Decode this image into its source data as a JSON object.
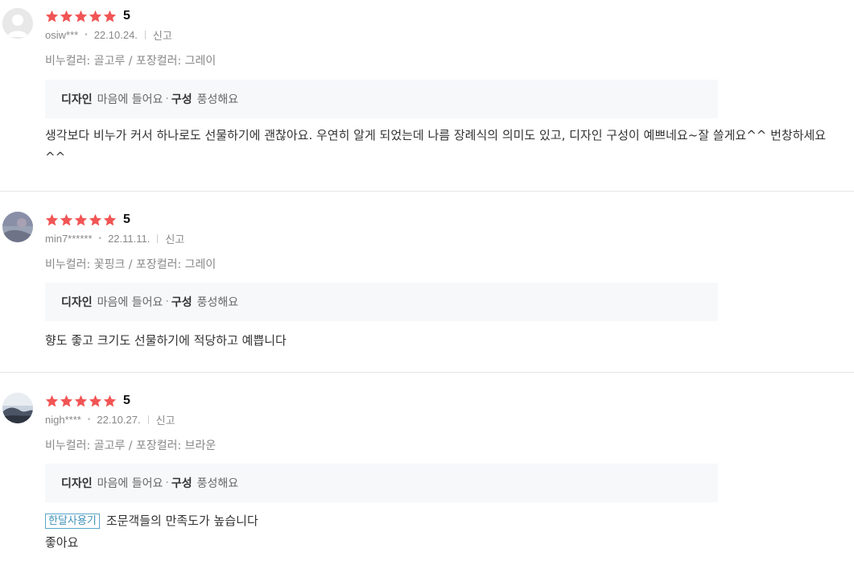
{
  "reviews": [
    {
      "score": "5",
      "user": "osiw***",
      "date": "22.10.24.",
      "report": "신고",
      "option": "비누컬러: 골고루 / 포장컬러: 그레이",
      "eval": [
        {
          "key": "디자인",
          "value": "마음에 들어요"
        },
        {
          "key": "구성",
          "value": "풍성해요"
        }
      ],
      "badge": "",
      "headline": "",
      "text": "생각보다 비누가 커서 하나로도 선물하기에 괜찮아요. 우연히 알게 되었는데 나름 장례식의 의미도 있고, 디자인 구성이 예쁘네요~잘 쓸게요^^ 번창하세요^^"
    },
    {
      "score": "5",
      "user": "min7******",
      "date": "22.11.11.",
      "report": "신고",
      "option": "비누컬러: 꽃핑크 / 포장컬러: 그레이",
      "eval": [
        {
          "key": "디자인",
          "value": "마음에 들어요"
        },
        {
          "key": "구성",
          "value": "풍성해요"
        }
      ],
      "badge": "",
      "headline": "",
      "text": "향도 좋고 크기도 선물하기에 적당하고 예쁩니다"
    },
    {
      "score": "5",
      "user": "nigh****",
      "date": "22.10.27.",
      "report": "신고",
      "option": "비누컬러: 골고루 / 포장컬러: 브라운",
      "eval": [
        {
          "key": "디자인",
          "value": "마음에 들어요"
        },
        {
          "key": "구성",
          "value": "풍성해요"
        }
      ],
      "badge": "한달사용기",
      "headline": "조문객들의 만족도가 높습니다",
      "text": "좋아요"
    }
  ],
  "colors": {
    "star": "#f15555",
    "badge_border": "#5aa6c9",
    "eval_bg": "#f7f8fa"
  },
  "icons": {
    "star": "star-icon",
    "avatar": "avatar-icon"
  }
}
